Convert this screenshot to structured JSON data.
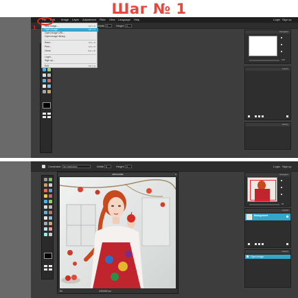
{
  "step_title": "Шаг № 1",
  "top": {
    "menu": [
      "File",
      "Edit",
      "Image",
      "Layer",
      "Adjustment",
      "Filter",
      "View",
      "Language",
      "Help"
    ],
    "right_links": [
      "Login",
      "Sign up"
    ],
    "options": {
      "width_label": "Width",
      "width_value": "0",
      "height_label": "Height",
      "height_value": "0"
    },
    "file_menu": {
      "items": [
        {
          "label": "New image...",
          "shortcut": "Ctrl + N"
        },
        {
          "label": "Open image...",
          "shortcut": "Ctrl + O",
          "selected": true
        },
        {
          "label": "Open image URL...",
          "shortcut": ""
        },
        {
          "label": "Open image library...",
          "shortcut": ""
        },
        {
          "label": "Save...",
          "shortcut": "Ctrl + S"
        },
        {
          "label": "Print...",
          "shortcut": "Ctrl + P"
        },
        {
          "label": "Close",
          "shortcut": "Ctrl + W"
        },
        {
          "label": "Login...",
          "shortcut": ""
        },
        {
          "label": "Sign up...",
          "shortcut": ""
        },
        {
          "label": "Exit",
          "shortcut": "Ctrl + Q"
        }
      ]
    },
    "panels": {
      "navigator": "Navigator",
      "layers": "Layers",
      "history": "History"
    },
    "zoom_value": "100"
  },
  "bottom": {
    "menu": [
      "File",
      "Edit",
      "Image",
      "Layer",
      "Adjustment",
      "Filter",
      "View",
      "Language",
      "Help"
    ],
    "right_links": [
      "Login",
      "Sign up"
    ],
    "options": {
      "constrain_label": "Constraint",
      "constrain_value": "No restriction",
      "width_label": "Width",
      "width_value": "0",
      "height_label": "Height",
      "height_value": "0"
    },
    "document": {
      "title": "alenushka",
      "zoom": "84",
      "dims": "440x640 px"
    },
    "panels": {
      "navigator": "Navigator",
      "layers": "Layers",
      "history": "History"
    },
    "layer_name": "Background",
    "history_item": "Open image",
    "zoom_value": "84"
  },
  "annotation": {
    "marker": "1"
  },
  "colors": {
    "accent": "#33a6cc",
    "annotation_red": "#e0241a",
    "title_red": "#e8463d"
  }
}
